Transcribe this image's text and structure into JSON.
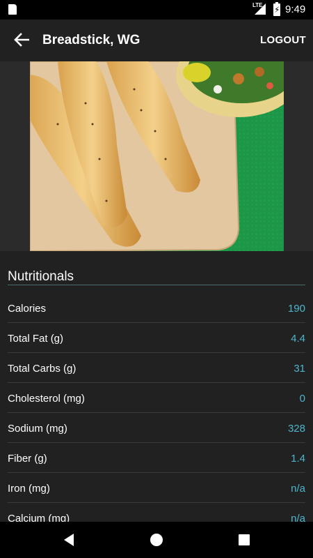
{
  "status_bar": {
    "network": "LTE",
    "time": "9:49",
    "icons": [
      "sd-card-icon",
      "signal-icon",
      "battery-charging-icon"
    ]
  },
  "app_bar": {
    "title": "Breadstick, WG",
    "logout_label": "LOGOUT",
    "back_icon": "arrow-back-icon"
  },
  "hero": {
    "image": "breadsticks-photo"
  },
  "nutrition": {
    "heading": "Nutritionals",
    "rows": [
      {
        "label": "Calories",
        "value": "190"
      },
      {
        "label": "Total Fat (g)",
        "value": "4.4"
      },
      {
        "label": "Total Carbs (g)",
        "value": "31"
      },
      {
        "label": "Cholesterol (mg)",
        "value": "0"
      },
      {
        "label": "Sodium (mg)",
        "value": "328"
      },
      {
        "label": "Fiber (g)",
        "value": "1.4"
      },
      {
        "label": "Iron (mg)",
        "value": "n/a"
      },
      {
        "label": "Calcium (mg)",
        "value": "n/a"
      }
    ]
  },
  "colors": {
    "background": "#212121",
    "value_accent": "#4db6cc",
    "divider": "#3a3a3a"
  },
  "nav_bar": {
    "icons": [
      "back-triangle-icon",
      "home-circle-icon",
      "recents-square-icon"
    ]
  }
}
